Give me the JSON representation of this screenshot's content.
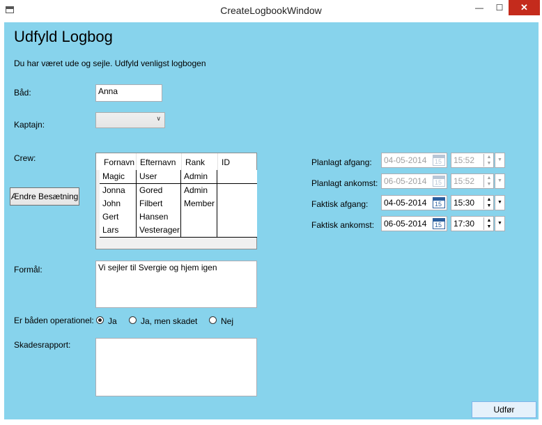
{
  "window": {
    "title": "CreateLogbookWindow",
    "minimize_glyph": "—",
    "maximize_glyph": "☐",
    "close_glyph": "✕",
    "background_color": "#87d3ec"
  },
  "heading": "Udfyld Logbog",
  "intro": "Du har været ude og sejle. Udfyld venligst logbogen",
  "boat": {
    "label": "Båd:",
    "value": "Anna"
  },
  "captain": {
    "label": "Kaptajn:",
    "value": ""
  },
  "crew": {
    "label": "Crew:",
    "change_button": "Ændre Besætning",
    "columns": [
      "Fornavn",
      "Efternavn",
      "Rank",
      "ID"
    ],
    "rows": [
      [
        "Magic",
        "User",
        "Admin",
        ""
      ],
      [
        "Jonna",
        "Gored",
        "Admin",
        ""
      ],
      [
        "John",
        "Filbert",
        "Member",
        ""
      ],
      [
        "Gert",
        "Hansen",
        "",
        ""
      ],
      [
        "Lars",
        "Vesterager",
        "",
        ""
      ]
    ]
  },
  "purpose": {
    "label": "Formål:",
    "value": "Vi sejler til Svergie og hjem igen"
  },
  "operational": {
    "label": "Er båden operationel:",
    "options": [
      "Ja",
      "Ja, men skadet",
      "Nej"
    ],
    "selected": "Ja"
  },
  "damage_report": {
    "label": "Skadesrapport:",
    "value": ""
  },
  "times": {
    "planned_departure": {
      "label": "Planlagt afgang:",
      "date": "04-05-2014",
      "time": "15:52",
      "enabled": false
    },
    "planned_arrival": {
      "label": "Planlagt ankomst:",
      "date": "06-05-2014",
      "time": "15:52",
      "enabled": false
    },
    "actual_departure": {
      "label": "Faktisk afgang:",
      "date": "04-05-2014",
      "time": "15:30",
      "enabled": true
    },
    "actual_arrival": {
      "label": "Faktisk ankomst:",
      "date": "06-05-2014",
      "time": "17:30",
      "enabled": true
    },
    "calendar_glyph_text": "15"
  },
  "submit_button": "Udfør"
}
